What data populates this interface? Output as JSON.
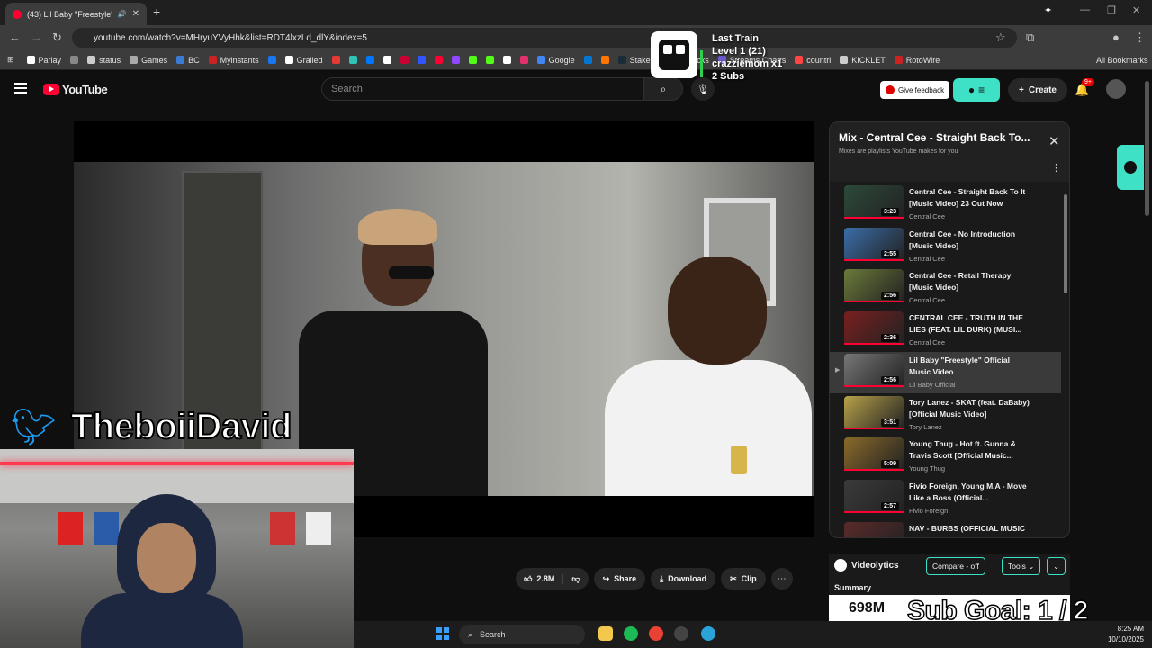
{
  "browser": {
    "tab_title": "(43) Lil Baby \"Freestyle\" Offi",
    "url": "youtube.com/watch?v=MHryuYVyHhk&list=RDT4lxzLd_dlY&index=5",
    "bookmarks": [
      {
        "label": "Parlay",
        "color": "#ffffff"
      },
      {
        "label": "",
        "color": "#888888"
      },
      {
        "label": "status",
        "color": "#cccccc"
      },
      {
        "label": "Games",
        "color": "#aaaaaa"
      },
      {
        "label": "BC",
        "color": "#3a7bd5"
      },
      {
        "label": "Myinstants",
        "color": "#cc2222"
      },
      {
        "label": "",
        "color": "#1877f2"
      },
      {
        "label": "Grailed",
        "color": "#ffffff"
      },
      {
        "label": "",
        "color": "#e53935"
      },
      {
        "label": "",
        "color": "#2ec4b6"
      },
      {
        "label": "",
        "color": "#0077ff"
      },
      {
        "label": "",
        "color": "#ffffff"
      },
      {
        "label": "",
        "color": "#cc0033"
      },
      {
        "label": "",
        "color": "#3355ff"
      },
      {
        "label": "",
        "color": "#ff0033"
      },
      {
        "label": "",
        "color": "#9146ff"
      },
      {
        "label": "",
        "color": "#53fc18"
      },
      {
        "label": "",
        "color": "#53fc18"
      },
      {
        "label": "",
        "color": "#ffffff"
      },
      {
        "label": "",
        "color": "#e1306c"
      },
      {
        "label": "Google",
        "color": "#4285f4"
      },
      {
        "label": "",
        "color": "#0078d4"
      },
      {
        "label": "",
        "color": "#ff7700"
      },
      {
        "label": "Stake",
        "color": "#1a2c38"
      },
      {
        "label": "PrizePicks",
        "color": "#7b2ff7"
      },
      {
        "label": "Streams Charts",
        "color": "#6a5acd"
      },
      {
        "label": "countri",
        "color": "#ff4444"
      },
      {
        "label": "KICKLET",
        "color": "#cccccc"
      },
      {
        "label": "RotoWire",
        "color": "#cc2222"
      }
    ],
    "all_bookmarks": "All Bookmarks"
  },
  "youtube": {
    "logo_text": "YouTube",
    "search_placeholder": "Search",
    "feedback_label": "Give feedback",
    "create_label": "Create",
    "notif_badge": "9+"
  },
  "actions": {
    "likes": "2.8M",
    "share": "Share",
    "download": "Download",
    "clip": "Clip"
  },
  "playlist": {
    "title": "Mix - Central Cee - Straight Back To...",
    "subtitle": "Mixes are playlists YouTube makes for you",
    "items": [
      {
        "title": "Central Cee - Straight Back To It [Music Video] 23 Out Now",
        "channel": "Central Cee",
        "duration": "3:23",
        "thumb": "#2c4a3a",
        "active": false
      },
      {
        "title": "Central Cee - No Introduction [Music Video]",
        "channel": "Central Cee",
        "duration": "2:55",
        "thumb": "#3a6ea8",
        "active": false
      },
      {
        "title": "Central Cee - Retail Therapy [Music Video]",
        "channel": "Central Cee",
        "duration": "2:56",
        "thumb": "#6b7a3a",
        "active": false
      },
      {
        "title": "CENTRAL CEE - TRUTH IN THE LIES (FEAT. LIL DURK) (MUSI...",
        "channel": "Central Cee",
        "duration": "2:36",
        "thumb": "#7a1f1f",
        "active": false
      },
      {
        "title": "Lil Baby \"Freestyle\" Official Music Video",
        "channel": "Lil Baby Official",
        "duration": "2:56",
        "thumb": "#777777",
        "active": true
      },
      {
        "title": "Tory Lanez - SKAT (feat. DaBaby) [Official Music Video]",
        "channel": "Tory Lanez",
        "duration": "3:51",
        "thumb": "#b8a24a",
        "active": false
      },
      {
        "title": "Young Thug - Hot ft. Gunna & Travis Scott [Official Music...",
        "channel": "Young Thug",
        "duration": "5:09",
        "thumb": "#8a6a2a",
        "active": false
      },
      {
        "title": "Fivio Foreign, Young M.A - Move Like a Boss (Official...",
        "channel": "Fivio Foreign",
        "duration": "2:57",
        "thumb": "#3a3a3a",
        "active": false
      },
      {
        "title": "NAV - BURBS (OFFICIAL MUSIC VIDEO)",
        "channel": "",
        "duration": "",
        "thumb": "#5a2a2a",
        "active": false
      }
    ]
  },
  "videolytics": {
    "name": "Videolytics",
    "compare": "Compare - off",
    "tools": "Tools",
    "summary": "Summary",
    "views": "698M"
  },
  "overlay": {
    "twitter_handle": "TheboiiDavid",
    "train_title": "Last Train",
    "train_level": "Level 1  (21)",
    "train_user": "crazziemom x1",
    "train_subs": "2 Subs",
    "sub_goal": "Sub Goal:  1 / 2"
  },
  "taskbar": {
    "search": "Search",
    "time": "8:25 AM",
    "date": "10/10/2025"
  }
}
